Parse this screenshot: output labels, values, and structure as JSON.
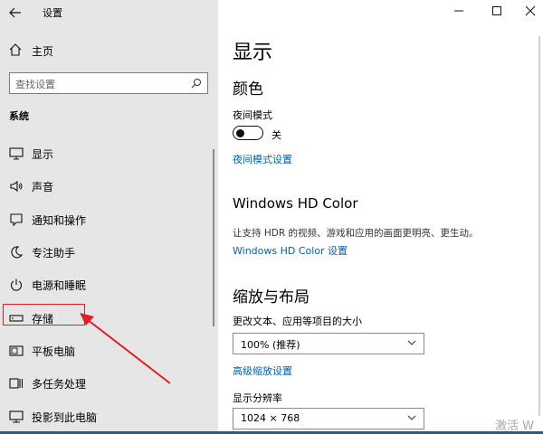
{
  "window": {
    "title": "设置",
    "back_icon": "back-arrow-icon",
    "controls": [
      "minimize-icon",
      "maximize-icon",
      "close-icon"
    ]
  },
  "sidebar": {
    "home_label": "主页",
    "search_placeholder": "查找设置",
    "section_label": "系统",
    "items": [
      {
        "label": "显示",
        "icon": "monitor-icon"
      },
      {
        "label": "声音",
        "icon": "speaker-icon"
      },
      {
        "label": "通知和操作",
        "icon": "notification-icon"
      },
      {
        "label": "专注助手",
        "icon": "moon-icon"
      },
      {
        "label": "电源和睡眠",
        "icon": "power-icon"
      },
      {
        "label": "存储",
        "icon": "storage-icon"
      },
      {
        "label": "平板电脑",
        "icon": "tablet-icon"
      },
      {
        "label": "多任务处理",
        "icon": "multitask-icon"
      },
      {
        "label": "投影到此电脑",
        "icon": "project-icon"
      }
    ]
  },
  "main": {
    "page_title": "显示",
    "color_section": "颜色",
    "night_mode_label": "夜间模式",
    "night_mode_state": "关",
    "night_mode_settings_link": "夜间模式设置",
    "hd_color_title": "Windows HD Color",
    "hd_color_desc": "让支持 HDR 的视频、游戏和应用的画面更明亮、更生动。",
    "hd_color_link": "Windows HD Color 设置",
    "scale_section": "缩放与布局",
    "scale_label": "更改文本、应用等项目的大小",
    "scale_value": "100% (推荐)",
    "advanced_scale_link": "高级缩放设置",
    "resolution_label": "显示分辨率",
    "resolution_value": "1024 × 768"
  },
  "watermark": "激活 W"
}
